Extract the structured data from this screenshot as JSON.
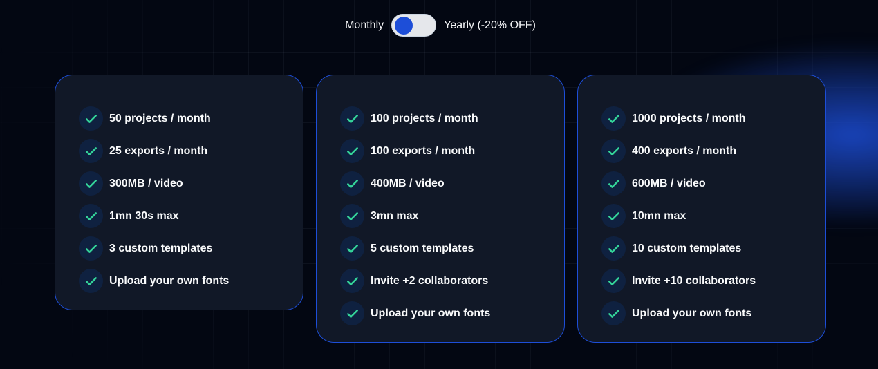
{
  "billing_toggle": {
    "left_label": "Monthly",
    "right_label": "Yearly (-20% OFF)",
    "state": "Monthly"
  },
  "colors": {
    "accent": "#1d4ed8",
    "check": "#34d399",
    "card_bg": "#111827",
    "page_bg": "#030712"
  },
  "plans": [
    {
      "features": [
        "50 projects / month",
        "25 exports / month",
        "300MB / video",
        "1mn 30s max",
        "3 custom templates",
        "Upload your own fonts"
      ]
    },
    {
      "features": [
        "100 projects / month",
        "100 exports / month",
        "400MB / video",
        "3mn max",
        "5 custom templates",
        "Invite +2 collaborators",
        "Upload your own fonts"
      ]
    },
    {
      "features": [
        "1000 projects / month",
        "400 exports / month",
        "600MB / video",
        "10mn max",
        "10 custom templates",
        "Invite +10 collaborators",
        "Upload your own fonts"
      ]
    }
  ],
  "icons": {
    "feature_icon": "check-icon"
  }
}
